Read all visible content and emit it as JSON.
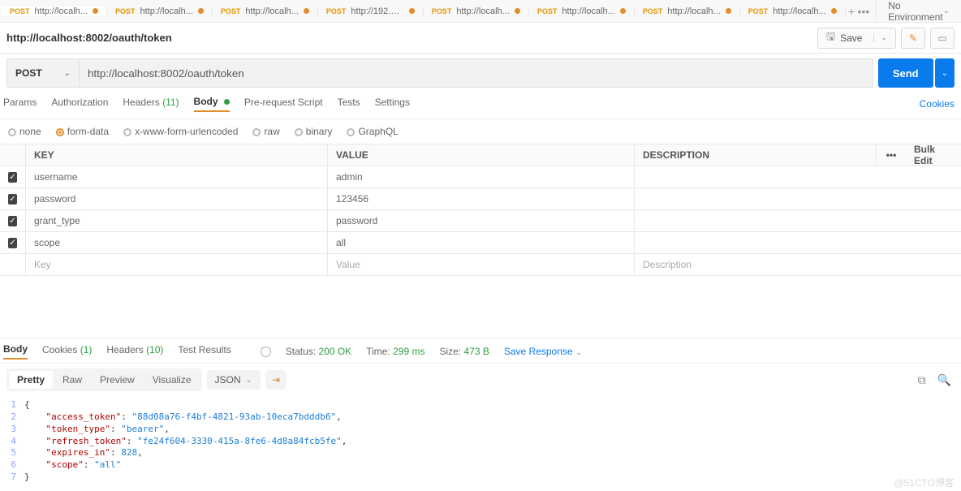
{
  "tabs": [
    {
      "method": "POST",
      "title": "http://localh...",
      "dirty": true,
      "active": true
    },
    {
      "method": "POST",
      "title": "http://localh...",
      "dirty": true
    },
    {
      "method": "POST",
      "title": "http://localh...",
      "dirty": true
    },
    {
      "method": "POST",
      "title": "http://192.16...",
      "dirty": true
    },
    {
      "method": "POST",
      "title": "http://localh...",
      "dirty": true
    },
    {
      "method": "POST",
      "title": "http://localh...",
      "dirty": true
    },
    {
      "method": "POST",
      "title": "http://localh...",
      "dirty": true
    },
    {
      "method": "POST",
      "title": "http://localh...",
      "dirty": true
    }
  ],
  "environment": {
    "label": "No Environment"
  },
  "page_title": "http://localhost:8002/oauth/token",
  "toolbar": {
    "save": "Save"
  },
  "request": {
    "method": "POST",
    "url": "http://localhost:8002/oauth/token",
    "send": "Send",
    "tabs": {
      "params": "Params",
      "auth": "Authorization",
      "headers": "Headers",
      "headers_count": "(11)",
      "body": "Body",
      "prereq": "Pre-request Script",
      "tests": "Tests",
      "settings": "Settings",
      "cookies": "Cookies"
    },
    "body_types": {
      "none": "none",
      "form_data": "form-data",
      "xwww": "x-www-form-urlencoded",
      "raw": "raw",
      "binary": "binary",
      "graphql": "GraphQL"
    }
  },
  "form_table": {
    "headers": {
      "key": "KEY",
      "value": "VALUE",
      "desc": "DESCRIPTION",
      "bulk": "Bulk Edit"
    },
    "rows": [
      {
        "checked": true,
        "key": "username",
        "value": "admin"
      },
      {
        "checked": true,
        "key": "password",
        "value": "123456"
      },
      {
        "checked": true,
        "key": "grant_type",
        "value": "password"
      },
      {
        "checked": true,
        "key": "scope",
        "value": "all"
      }
    ],
    "placeholders": {
      "key": "Key",
      "value": "Value",
      "desc": "Description"
    }
  },
  "response": {
    "tabs": {
      "body": "Body",
      "cookies": "Cookies",
      "cookies_count": "(1)",
      "headers": "Headers",
      "headers_count": "(10)",
      "tests": "Test Results"
    },
    "status_label": "Status:",
    "status_value": "200 OK",
    "time_label": "Time:",
    "time_value": "299 ms",
    "size_label": "Size:",
    "size_value": "473 B",
    "save_response": "Save Response",
    "view": {
      "pretty": "Pretty",
      "raw": "Raw",
      "preview": "Preview",
      "visualize": "Visualize",
      "format": "JSON"
    },
    "json": {
      "access_token": "88d08a76-f4bf-4821-93ab-10eca7bdddb6",
      "token_type": "bearer",
      "refresh_token": "fe24f604-3330-415a-8fe6-4d8a84fcb5fe",
      "expires_in": 828,
      "scope": "all"
    }
  },
  "watermark": "@51CTO博客"
}
